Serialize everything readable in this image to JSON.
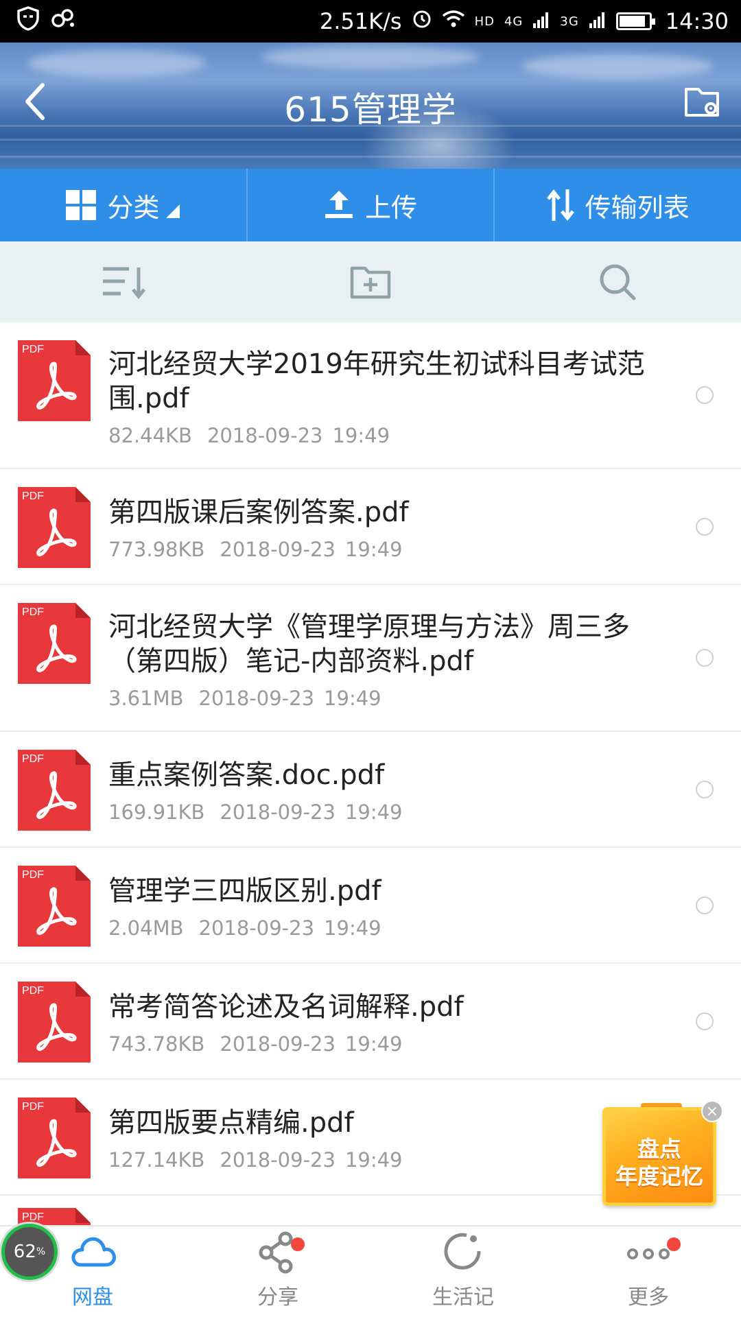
{
  "status_bar": {
    "net_speed": "2.51K/s",
    "hd": "HD",
    "sig_4g": "4G",
    "sig_3g": "3G",
    "time": "14:30",
    "battery_level": 0.9
  },
  "header": {
    "title": "615管理学"
  },
  "action_bar": {
    "items": [
      {
        "label": "分类",
        "icon": "grid-icon"
      },
      {
        "label": "上传",
        "icon": "upload-icon"
      },
      {
        "label": "传输列表",
        "icon": "transfer-icon"
      }
    ]
  },
  "tool_row": {
    "icons": [
      "sort-icon",
      "new-folder-icon",
      "search-icon"
    ]
  },
  "files": [
    {
      "name": "河北经贸大学2019年研究生初试科目考试范围.pdf",
      "size": "82.44KB",
      "date": "2018-09-23",
      "time": "19:49",
      "icon_label": "PDF"
    },
    {
      "name": "第四版课后案例答案.pdf",
      "size": "773.98KB",
      "date": "2018-09-23",
      "time": "19:49",
      "icon_label": "PDF"
    },
    {
      "name": "河北经贸大学《管理学原理与方法》周三多（第四版）笔记-内部资料.pdf",
      "size": "3.61MB",
      "date": "2018-09-23",
      "time": "19:49",
      "icon_label": "PDF"
    },
    {
      "name": "重点案例答案.doc.pdf",
      "size": "169.91KB",
      "date": "2018-09-23",
      "time": "19:49",
      "icon_label": "PDF"
    },
    {
      "name": "管理学三四版区别.pdf",
      "size": "2.04MB",
      "date": "2018-09-23",
      "time": "19:49",
      "icon_label": "PDF"
    },
    {
      "name": "常考简答论述及名词解释.pdf",
      "size": "743.78KB",
      "date": "2018-09-23",
      "time": "19:49",
      "icon_label": "PDF"
    },
    {
      "name": "第四版要点精编.pdf",
      "size": "127.14KB",
      "date": "2018-09-23",
      "time": "19:49",
      "icon_label": "PDF"
    }
  ],
  "partial_file": {
    "icon_label": "PDF"
  },
  "promo": {
    "line1": "盘点",
    "line2": "年度记忆",
    "close": "×"
  },
  "progress_badge": {
    "value": "62",
    "unit": "%"
  },
  "bottom_nav": {
    "items": [
      {
        "label": "网盘",
        "active": true
      },
      {
        "label": "分享",
        "badge": true
      },
      {
        "label": "生活记"
      },
      {
        "label": "更多",
        "badge": true
      }
    ]
  },
  "colors": {
    "accent": "#2f8fe8",
    "pdf_red": "#e8383b",
    "badge_red": "#f2453d",
    "promo_orange": "#ffa51a"
  }
}
